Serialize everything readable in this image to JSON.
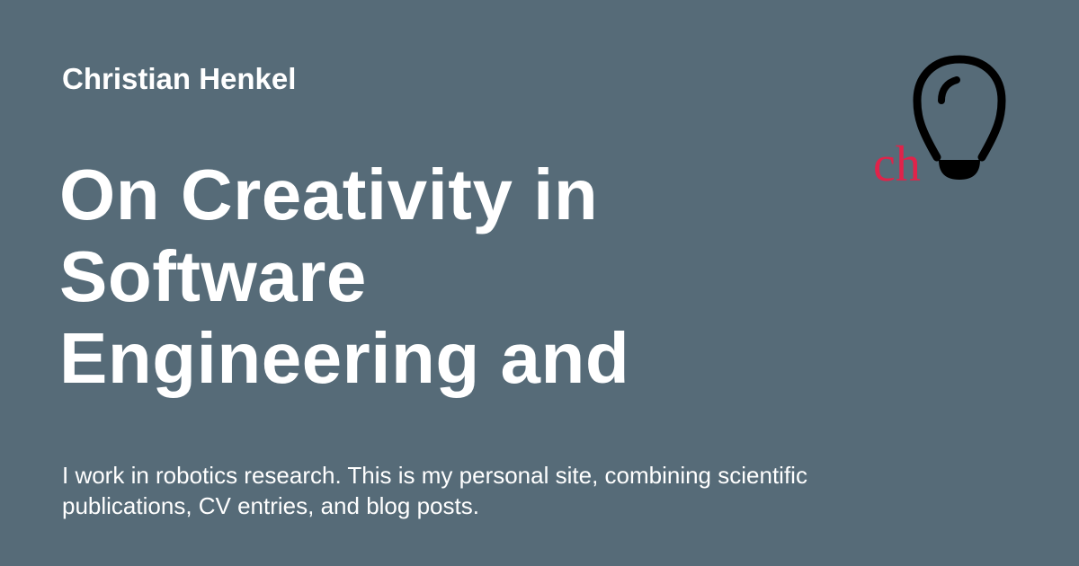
{
  "colors": {
    "background": "#566b78",
    "text": "#ffffff",
    "logo_stroke": "#000000",
    "logo_accent": "#e0234a"
  },
  "header": {
    "author": "Christian Henkel"
  },
  "main": {
    "title_lines": [
      "On Creativity in",
      "Software",
      "Engineering and"
    ],
    "description": "I work in robotics research. This is my personal site, combining scientific publications, CV entries, and blog posts."
  },
  "logo": {
    "icon": "lightbulb-icon",
    "monogram": "ch"
  }
}
